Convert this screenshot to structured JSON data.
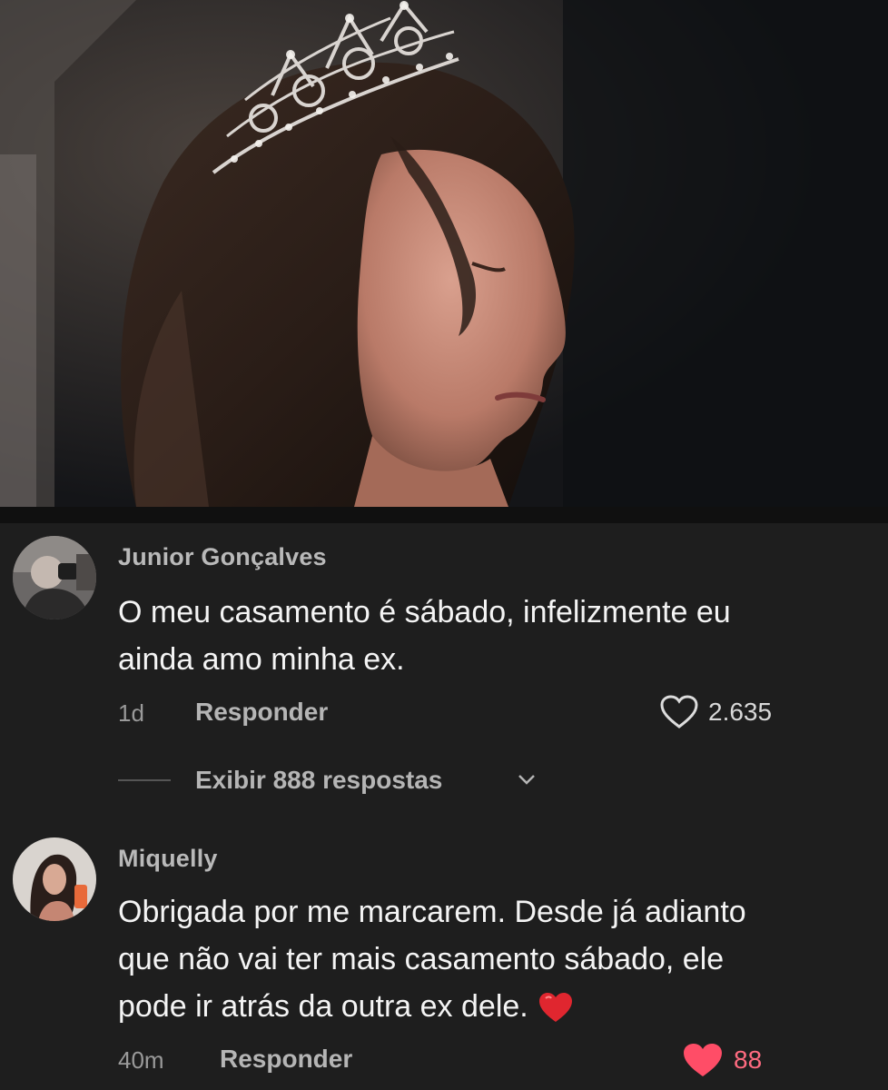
{
  "video": {
    "description_icon": "crowned-woman-thumbnail"
  },
  "comments": [
    {
      "username": "Junior Gonçalves",
      "text": "O meu casamento é sábado, infelizmente eu ainda amo minha ex.",
      "line1": "O meu casamento é sábado, infelizmente eu",
      "line2": "ainda amo minha ex.",
      "time": "1d",
      "reply_label": "Responder",
      "likes": "2.635",
      "liked": false,
      "view_replies": "Exibir 888 respostas"
    },
    {
      "username": "Miquelly",
      "line1": "Obrigada por me marcarem. Desde já adianto",
      "line2": "que não vai ter mais casamento sábado, ele",
      "line3": "pode ir atrás da outra ex dele.",
      "emoji_icon": "red-heart-emoji",
      "time": "40m",
      "reply_label": "Responder",
      "likes": "88",
      "liked": true,
      "like_color": "#ff4d67"
    }
  ]
}
